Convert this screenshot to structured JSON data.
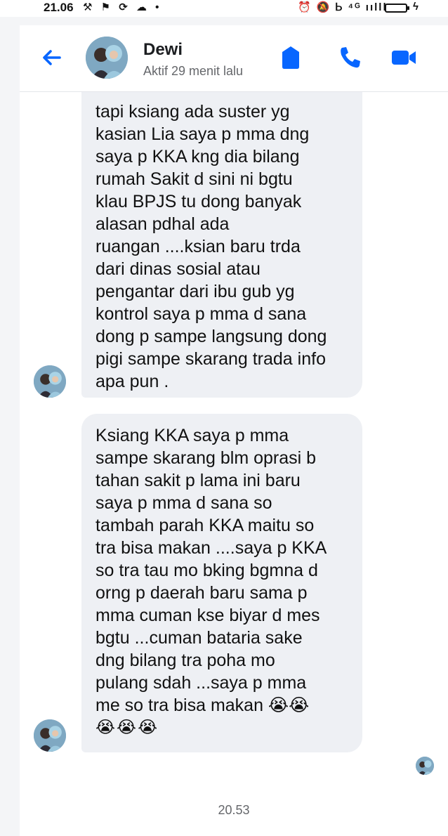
{
  "status_bar": {
    "time": "21.06",
    "left_icons": [
      "tool-icon",
      "flag-icon",
      "sync-icon",
      "cloud-icon",
      "dot-icon"
    ],
    "right_icons": [
      "alarm-icon",
      "mute-icon",
      "volte-icon",
      "signal-icon",
      "battery-icon"
    ],
    "left_glyphs": "⚒ ⚑ ⟳ ☁ •",
    "right_glyphs": "⏰ 🔕 Ꮟ ⁴ᴳ ıılll"
  },
  "header": {
    "contact_name": "Dewi",
    "contact_status": "Aktif 29 menit lalu",
    "icons": [
      "back-arrow-icon",
      "shield-icon",
      "phone-icon",
      "video-camera-icon"
    ],
    "accent_color": "#0866ff"
  },
  "messages": [
    {
      "sender": "Dewi",
      "lines": [
        "tapi ksiang ada suster yg",
        "kasian Lia saya p mma dng",
        "saya p KKA kng dia bilang",
        "rumah Sakit d sini ni bgtu",
        "klau BPJS tu dong banyak",
        "alasan pdhal ada",
        "ruangan ....ksian baru trda",
        "dari dinas sosial atau",
        "pengantar dari ibu gub yg",
        "kontrol saya p mma d sana",
        "dong p sampe langsung dong",
        "pigi sampe skarang trada info",
        "apa pun ."
      ]
    },
    {
      "sender": "Dewi",
      "lines": [
        "Ksiang KKA saya p mma",
        "sampe skarang blm oprasi b",
        "tahan sakit p lama ini baru",
        "saya p mma d sana so",
        "tambah parah KKA maitu so",
        "tra bisa makan ....saya p KKA",
        "so tra tau mo bking bgmna d",
        "orng p daerah baru sama p",
        "mma cuman kse biyar d mes",
        "bgtu ...cuman bataria sake",
        "dng bilang tra poha mo",
        "pulang sdah ...saya p mma",
        "me so tra bisa makan 😭😭",
        "😭😭😭"
      ]
    }
  ],
  "timestamp": "20.53",
  "colors": {
    "bubble_bg": "#eef0f4",
    "chat_bg": "#ffffff",
    "secondary_text": "#65676b"
  }
}
